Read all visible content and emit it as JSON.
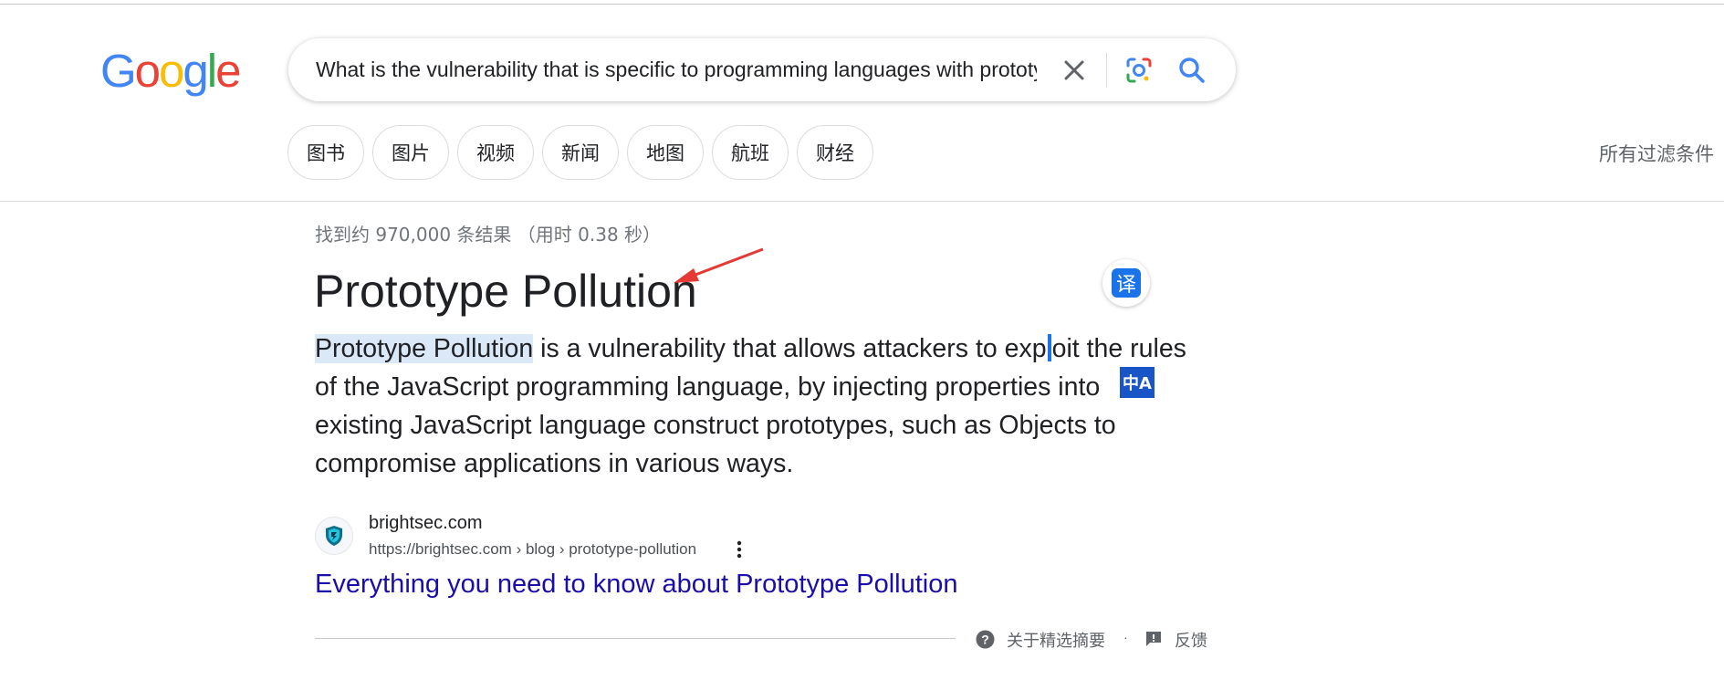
{
  "logo": {
    "letters": [
      "G",
      "o",
      "o",
      "g",
      "l",
      "e"
    ],
    "colors": [
      "#4285F4",
      "#EA4335",
      "#FBBC05",
      "#4285F4",
      "#34A853",
      "#EA4335"
    ]
  },
  "search": {
    "value": "What is the vulnerability that is specific to programming languages with prototype-based inheritance?",
    "clear_icon": "close-icon",
    "lens_icon": "google-lens-icon",
    "search_icon": "search-icon"
  },
  "chips": [
    "图书",
    "图片",
    "视频",
    "新闻",
    "地图",
    "航班",
    "财经"
  ],
  "all_filters": "所有过滤条件",
  "result_stats": "找到约 970,000 条结果 （用时 0.38 秒）",
  "featured_snippet": {
    "title": "Prototype Pollution",
    "highlight": "Prototype Pollution",
    "text_part1": " is a vulnerability that allows attackers to exp",
    "text_part2": "oit the rules of the JavaScript programming language, by injecting propert",
    "text_part3": "ies into existing JavaScript language construct prototypes, such as Objects to compromise applications in various ways.",
    "translate_label": "译",
    "floating_translate_label": "中A"
  },
  "source": {
    "site_name": "brightsec.com",
    "url": "https://brightsec.com › blog › prototype-pollution",
    "link_title": "Everything you need to know about Prototype Pollution"
  },
  "footer": {
    "about_label": "关于精选摘要",
    "separator": "·",
    "feedback_label": "反馈"
  },
  "colors": {
    "link": "#1a0dab",
    "accent": "#1a73e8",
    "arrow": "#e53935"
  }
}
